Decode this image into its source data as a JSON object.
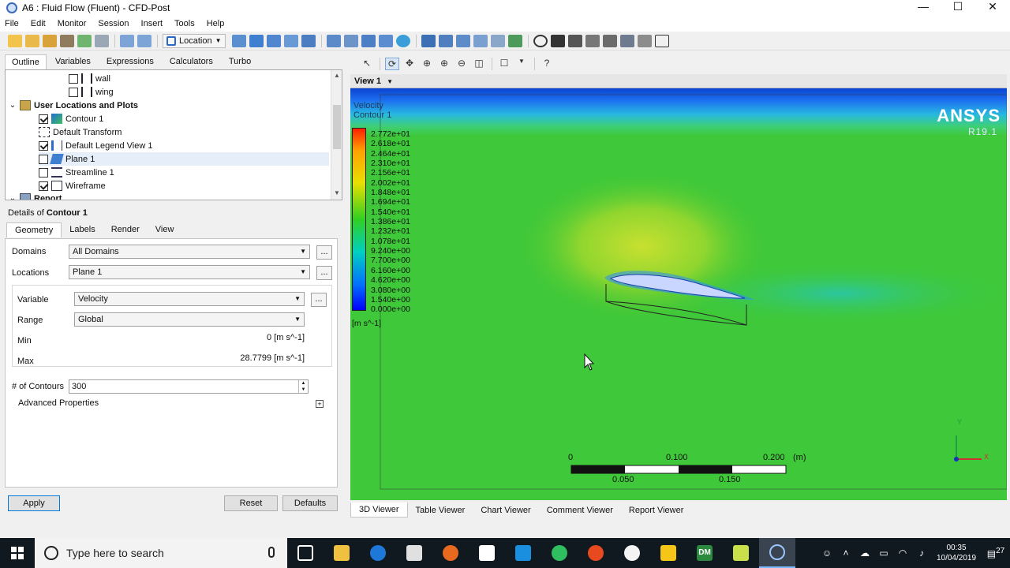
{
  "window": {
    "title": "A6 : Fluid Flow (Fluent) - CFD-Post",
    "controls": [
      "—",
      "☐",
      "✕"
    ]
  },
  "menu": [
    "File",
    "Edit",
    "Monitor",
    "Session",
    "Insert",
    "Tools",
    "Help"
  ],
  "toolbar": {
    "location_label": "Location"
  },
  "outline_tabs": [
    "Outline",
    "Variables",
    "Expressions",
    "Calculators",
    "Turbo"
  ],
  "tree": {
    "items": [
      {
        "label": "wall",
        "checked": false
      },
      {
        "label": "wing",
        "checked": false
      },
      {
        "label": "User Locations and Plots"
      },
      {
        "label": "Contour 1",
        "checked": true
      },
      {
        "label": "Default Transform"
      },
      {
        "label": "Default Legend View 1",
        "checked": true
      },
      {
        "label": "Plane 1",
        "checked": false
      },
      {
        "label": "Streamline 1",
        "checked": false
      },
      {
        "label": "Wireframe",
        "checked": true
      },
      {
        "label": "Report"
      }
    ]
  },
  "details": {
    "prefix": "Details of ",
    "object": "Contour 1",
    "tabs": [
      "Geometry",
      "Labels",
      "Render",
      "View"
    ],
    "domains_label": "Domains",
    "domains_value": "All Domains",
    "locations_label": "Locations",
    "locations_value": "Plane 1",
    "variable_label": "Variable",
    "variable_value": "Velocity",
    "range_label": "Range",
    "range_value": "Global",
    "min_label": "Min",
    "min_value": "0 [m s^-1]",
    "max_label": "Max",
    "max_value": "28.7799 [m s^-1]",
    "contours_label": "# of Contours",
    "contours_value": "300",
    "advanced_label": "Advanced Properties",
    "dots": "..."
  },
  "buttons": {
    "apply": "Apply",
    "reset": "Reset",
    "defaults": "Defaults"
  },
  "viewer": {
    "view_label": "View 1",
    "legend_title_1": "Velocity",
    "legend_title_2": "Contour 1",
    "legend_labels": [
      "2.772e+01",
      "2.618e+01",
      "2.464e+01",
      "2.310e+01",
      "2.156e+01",
      "2.002e+01",
      "1.848e+01",
      "1.694e+01",
      "1.540e+01",
      "1.386e+01",
      "1.232e+01",
      "1.078e+01",
      "9.240e+00",
      "7.700e+00",
      "6.160e+00",
      "4.620e+00",
      "3.080e+00",
      "1.540e+00",
      "0.000e+00"
    ],
    "legend_unit": "[m s^-1]",
    "brand": "ANSYS",
    "version": "R19.1",
    "scale_labels_top": [
      "0",
      "0.100",
      "0.200",
      "(m)"
    ],
    "scale_labels_bottom": [
      "0.050",
      "0.150"
    ],
    "axis": {
      "y": "Y",
      "x": "X"
    },
    "tabs": [
      "3D Viewer",
      "Table Viewer",
      "Chart Viewer",
      "Comment Viewer",
      "Report Viewer"
    ]
  },
  "taskbar": {
    "search_placeholder": "Type here to search",
    "time": "00:35",
    "date": "10/04/2019",
    "notifications": "27",
    "dm_label": "DM"
  }
}
